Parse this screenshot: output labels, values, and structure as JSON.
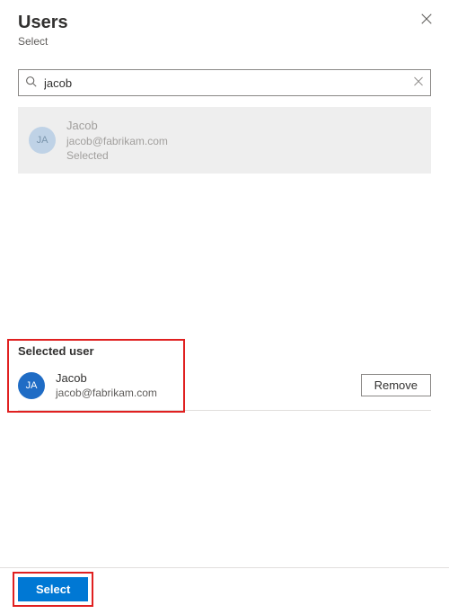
{
  "header": {
    "title": "Users",
    "subtitle": "Select"
  },
  "search": {
    "value": "jacob"
  },
  "result": {
    "avatar_initials": "JA",
    "name": "Jacob",
    "email": "jacob@fabrikam.com",
    "status": "Selected"
  },
  "selected": {
    "heading": "Selected user",
    "avatar_initials": "JA",
    "name": "Jacob",
    "email": "jacob@fabrikam.com",
    "remove_label": "Remove"
  },
  "footer": {
    "select_label": "Select"
  }
}
